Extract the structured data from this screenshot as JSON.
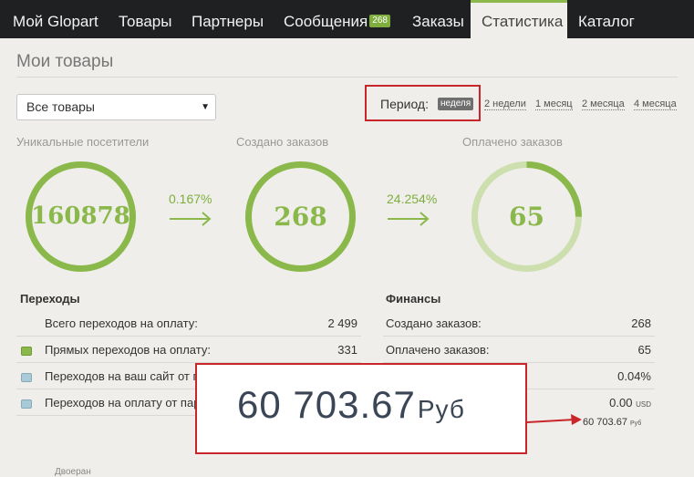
{
  "nav": {
    "tabs": [
      {
        "label": "Мой Glopart"
      },
      {
        "label": "Товары"
      },
      {
        "label": "Партнеры"
      },
      {
        "label": "Сообщения",
        "badge": "268"
      },
      {
        "label": "Заказы"
      },
      {
        "label": "Статистика",
        "active": true
      },
      {
        "label": "Каталог"
      }
    ]
  },
  "page": {
    "title": "Мои товары"
  },
  "filter": {
    "selected": "Все товары"
  },
  "period": {
    "label": "Период:",
    "active": "неделя",
    "options": [
      "2 недели",
      "1 месяц",
      "2 месяца",
      "4 месяца"
    ]
  },
  "stats": {
    "visitors": {
      "label": "Уникальные посетители",
      "value": "160878",
      "ring_fill": 1.0
    },
    "conv1": "0.167%",
    "orders": {
      "label": "Создано заказов",
      "value": "268",
      "ring_fill": 1.0
    },
    "conv2": "24.254%",
    "paid": {
      "label": "Оплачено заказов",
      "value": "65",
      "ring_fill": 0.25
    }
  },
  "transitions": {
    "title": "Переходы",
    "rows": [
      {
        "label": "Всего переходов на оплату:",
        "value": "2 499"
      },
      {
        "label": "Прямых переходов на оплату:",
        "value": "331"
      },
      {
        "label": "Переходов на ваш сайт от п",
        "value": ""
      },
      {
        "label": "Переходов на оплату от пар",
        "value": ""
      }
    ]
  },
  "finance": {
    "title": "Финансы",
    "rows": [
      {
        "label": "Создано заказов:",
        "value": "268"
      },
      {
        "label": "Оплачено заказов:",
        "value": "65"
      },
      {
        "label": "",
        "value": "0.04%"
      },
      {
        "label": "",
        "value": "0.00",
        "unit": "USD"
      }
    ],
    "total": {
      "value": "60 703.67",
      "unit": "Руб"
    }
  },
  "zoom": {
    "value": "60 703.67",
    "unit": "Руб"
  },
  "bottom": {
    "text": "Двоеран"
  },
  "colors": {
    "accent": "#8ab84a",
    "ring_light": "#cddfae",
    "sq_green": "#8ab84a",
    "sq_blue": "#a9cbd8",
    "callout": "#c8262a"
  }
}
